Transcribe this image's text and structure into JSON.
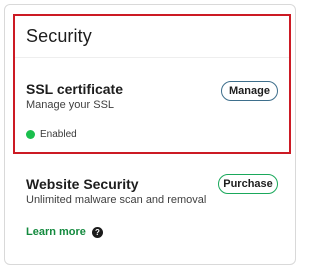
{
  "card": {
    "title": "Security"
  },
  "ssl": {
    "title": "SSL certificate",
    "subtitle": "Manage your SSL",
    "button_label": "Manage",
    "status_text": "Enabled",
    "status_color": "#1bbf4d"
  },
  "website_security": {
    "title": "Website Security",
    "subtitle": "Unlimited malware scan and removal",
    "button_label": "Purchase"
  },
  "learn_more": {
    "label": "Learn more",
    "icon_glyph": "?",
    "icon": "help-icon"
  },
  "colors": {
    "highlight_border": "#cc1a24",
    "link_green": "#138a3e",
    "purchase_border": "#1aa85b",
    "manage_border": "#3e6f8c"
  }
}
